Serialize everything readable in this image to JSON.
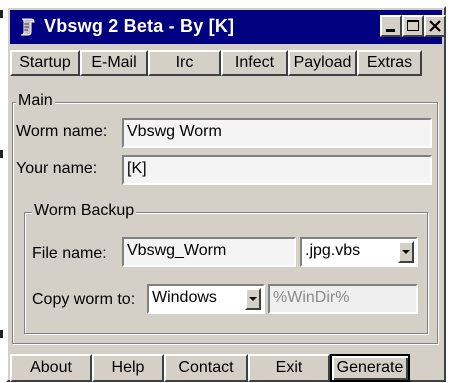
{
  "window": {
    "title": "Vbswg 2 Beta - By [K]",
    "icon": "app-scroll-icon",
    "colors": {
      "titlebar": "#000080",
      "face": "#d4d0c8"
    }
  },
  "tabs": [
    {
      "label": "Startup"
    },
    {
      "label": "E-Mail"
    },
    {
      "label": "Irc"
    },
    {
      "label": "Infect"
    },
    {
      "label": "Payload"
    },
    {
      "label": "Extras"
    }
  ],
  "main": {
    "group_label": "Main",
    "worm_name_label": "Worm name:",
    "worm_name_value": "Vbswg Worm",
    "your_name_label": "Your name:",
    "your_name_value": "[K]",
    "backup": {
      "group_label": "Worm Backup",
      "file_name_label": "File name:",
      "file_name_value": "Vbswg_Worm",
      "extension_value": ".jpg.vbs",
      "copy_to_label": "Copy worm to:",
      "copy_to_value": "Windows",
      "path_value": "%WinDir%"
    }
  },
  "buttons": [
    {
      "label": "About"
    },
    {
      "label": "Help"
    },
    {
      "label": "Contact"
    },
    {
      "label": "Exit"
    },
    {
      "label": "Generate"
    }
  ]
}
